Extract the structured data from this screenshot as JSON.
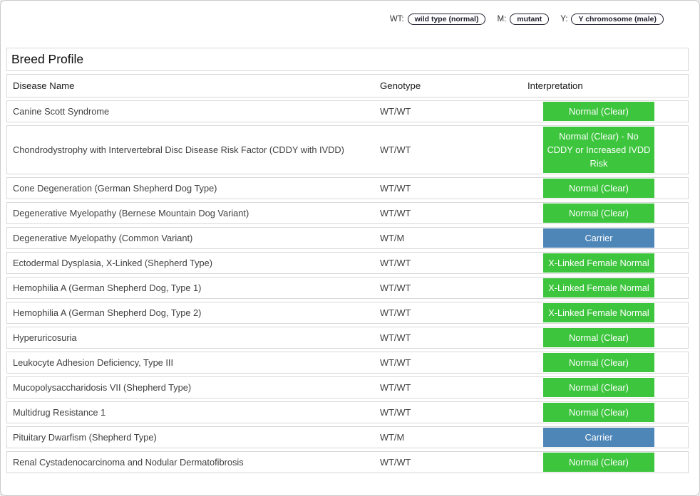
{
  "legend": {
    "items": [
      {
        "label": "WT:",
        "pill": "wild type (normal)"
      },
      {
        "label": "M:",
        "pill": "mutant"
      },
      {
        "label": "Y:",
        "pill": "Y chromosome (male)"
      }
    ]
  },
  "table": {
    "title": "Breed Profile",
    "columns": [
      "Disease Name",
      "Genotype",
      "Interpretation"
    ],
    "rows": [
      {
        "disease": "Canine Scott Syndrome",
        "genotype": "WT/WT",
        "interpretation": "Normal (Clear)",
        "badge": "green"
      },
      {
        "disease": "Chondrodystrophy with Intervertebral Disc Disease Risk Factor (CDDY with IVDD)",
        "genotype": "WT/WT",
        "interpretation": "Normal (Clear) - No CDDY or Increased IVDD Risk",
        "badge": "green"
      },
      {
        "disease": "Cone Degeneration (German Shepherd Dog Type)",
        "genotype": "WT/WT",
        "interpretation": "Normal (Clear)",
        "badge": "green"
      },
      {
        "disease": "Degenerative Myelopathy (Bernese Mountain Dog Variant)",
        "genotype": "WT/WT",
        "interpretation": "Normal (Clear)",
        "badge": "green"
      },
      {
        "disease": "Degenerative Myelopathy (Common Variant)",
        "genotype": "WT/M",
        "interpretation": "Carrier",
        "badge": "blue"
      },
      {
        "disease": "Ectodermal Dysplasia, X-Linked (Shepherd Type)",
        "genotype": "WT/WT",
        "interpretation": "X-Linked Female Normal",
        "badge": "green"
      },
      {
        "disease": "Hemophilia A (German Shepherd Dog, Type 1)",
        "genotype": "WT/WT",
        "interpretation": "X-Linked Female Normal",
        "badge": "green"
      },
      {
        "disease": "Hemophilia A (German Shepherd Dog, Type 2)",
        "genotype": "WT/WT",
        "interpretation": "X-Linked Female Normal",
        "badge": "green"
      },
      {
        "disease": "Hyperuricosuria",
        "genotype": "WT/WT",
        "interpretation": "Normal (Clear)",
        "badge": "green"
      },
      {
        "disease": "Leukocyte Adhesion Deficiency, Type III",
        "genotype": "WT/WT",
        "interpretation": "Normal (Clear)",
        "badge": "green"
      },
      {
        "disease": "Mucopolysaccharidosis VII (Shepherd Type)",
        "genotype": "WT/WT",
        "interpretation": "Normal (Clear)",
        "badge": "green"
      },
      {
        "disease": "Multidrug Resistance 1",
        "genotype": "WT/WT",
        "interpretation": "Normal (Clear)",
        "badge": "green"
      },
      {
        "disease": "Pituitary Dwarfism (Shepherd Type)",
        "genotype": "WT/M",
        "interpretation": "Carrier",
        "badge": "blue"
      },
      {
        "disease": "Renal Cystadenocarcinoma and Nodular Dermatofibrosis",
        "genotype": "WT/WT",
        "interpretation": "Normal (Clear)",
        "badge": "green"
      }
    ]
  },
  "colors": {
    "green": "#3dc53d",
    "blue": "#4e86b8"
  }
}
